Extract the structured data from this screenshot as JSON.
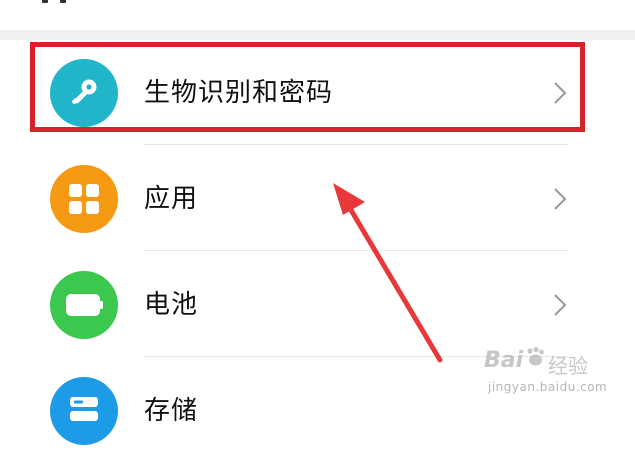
{
  "settings": {
    "items": [
      {
        "label": "生物识别和密码",
        "icon": "key-icon",
        "icon_color": "#20b5c8"
      },
      {
        "label": "应用",
        "icon": "apps-grid-icon",
        "icon_color": "#f59a12"
      },
      {
        "label": "电池",
        "icon": "battery-icon",
        "icon_color": "#3cc84e"
      },
      {
        "label": "存储",
        "icon": "storage-icon",
        "icon_color": "#1e9be6"
      }
    ]
  },
  "annotation": {
    "highlight_color": "#d6222a",
    "arrow_color": "#e8383a"
  },
  "watermark": {
    "brand": "Bai",
    "cn_text": "经验",
    "url": "jingyan.baidu.com"
  }
}
